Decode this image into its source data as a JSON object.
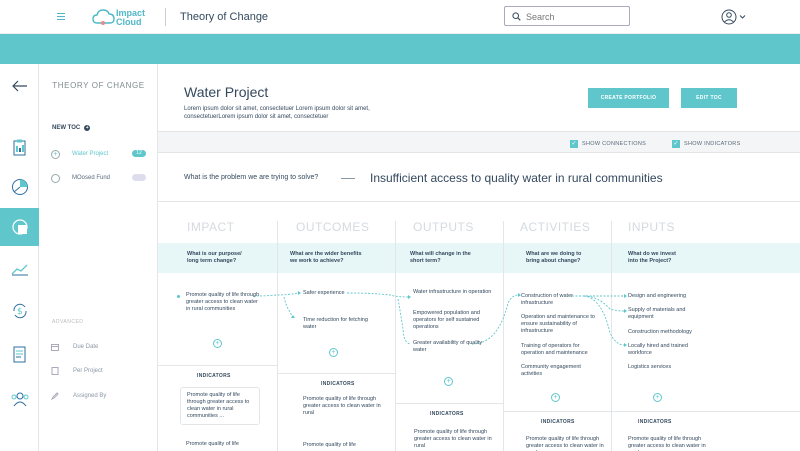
{
  "header": {
    "logo_text_1": "Impact",
    "logo_text_2": "Cloud",
    "app_title": "Theory of Change",
    "search_placeholder": "Search"
  },
  "rail": {
    "icons": [
      "back-arrow-icon",
      "clipboard-icon",
      "pie-chart-icon",
      "toc-icon",
      "trend-chart-icon",
      "dollar-cycle-icon",
      "report-icon",
      "people-icon"
    ],
    "active_index": 3
  },
  "side": {
    "title": "THEORY OF CHANGE",
    "new_toc": "NEW TOC",
    "items": [
      {
        "label": "Water Project",
        "badge": "12",
        "active": true
      },
      {
        "label": "MOosed Fund",
        "badge": "",
        "active": false
      }
    ],
    "advanced_label": "ADVANCED",
    "advanced_items": [
      "Due Date",
      "Per Project",
      "Assigned By"
    ]
  },
  "project": {
    "title": "Water Project",
    "description": "Lorem ipsum dolor sit amet, consectetuer Lorem ipsum dolor sit amet, consectetuerLorem ipsum dolor sit amet, consectetuer",
    "create_portfolio": "CREATE PORTFOLIO",
    "edit_toc": "EDIT TOC"
  },
  "options": {
    "show_connections": "SHOW CONNECTIONS",
    "show_indicators": "SHOW INDICATORS"
  },
  "problem": {
    "question": "What is the problem we are trying to solve?",
    "answer": "Insufficient access to quality water in rural communities"
  },
  "columns": [
    {
      "heading": "IMPACT",
      "question_1": "What is our purpose/",
      "question_2": "long term change?",
      "items": [
        "Promote quality of life through greater access to clean water in rural communities"
      ]
    },
    {
      "heading": "OUTCOMES",
      "question_1": "What are the wider benefits",
      "question_2": "we work to achieve?",
      "items": [
        "Safer experience",
        "Time reduction for fetching water"
      ]
    },
    {
      "heading": "OUTPUTS",
      "question_1": "What will change in the",
      "question_2": "short term?",
      "items": [
        "Water infrastructure in operation",
        "Empowered population and operators for self sustained operations",
        "Greater availability of quality water"
      ]
    },
    {
      "heading": "ACTIVITIES",
      "question_1": "What are we doing to",
      "question_2": "bring about change?",
      "items": [
        "Construction of water infrastructure",
        "Operation and maintenance to ensure sustainability of infrastructure",
        "Training of operators for operation and maintenance",
        "Community engagement activities"
      ]
    },
    {
      "heading": "INPUTS",
      "question_1": "What do we invest",
      "question_2": "into the Project?",
      "items": [
        "Design and engineering",
        "Supply of materials and equipment",
        "Construction methodology",
        "Locally hired and trained workforce",
        "Logistics services"
      ]
    }
  ],
  "indicators": {
    "label": "INDICATORS",
    "card_text": "Promote quality of life through greater access to clean water in rural communities ...",
    "card_short": "Promote quality of life through greater access to clean water in rural",
    "card_trunc": "Promote quality of life"
  },
  "colors": {
    "accent": "#5fc6cb",
    "text": "#34495e"
  }
}
